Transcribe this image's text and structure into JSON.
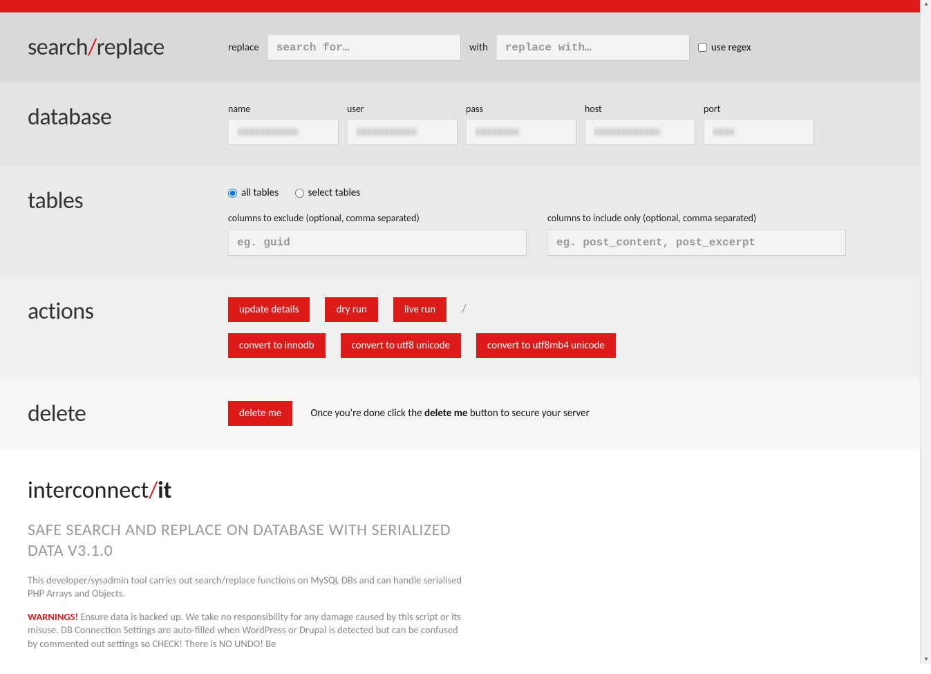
{
  "header": {
    "title_part1": "search",
    "title_slash": "/",
    "title_part2": "replace"
  },
  "replace_row": {
    "replace_label": "replace",
    "search_placeholder": "search for…",
    "with_label": "with",
    "replace_placeholder": "replace with…",
    "regex_label": "use regex"
  },
  "database": {
    "heading": "database",
    "fields": {
      "name_label": "name",
      "user_label": "user",
      "pass_label": "pass",
      "host_label": "host",
      "port_label": "port"
    }
  },
  "tables": {
    "heading": "tables",
    "all_tables_label": "all tables",
    "select_tables_label": "select tables",
    "exclude_label": "columns to exclude (optional, comma separated)",
    "exclude_placeholder": "eg. guid",
    "include_label": "columns to include only (optional, comma separated)",
    "include_placeholder": "eg. post_content, post_excerpt"
  },
  "actions": {
    "heading": "actions",
    "update_details": "update details",
    "dry_run": "dry run",
    "live_run": "live run",
    "separator": "/",
    "convert_innodb": "convert to innodb",
    "convert_utf8": "convert to utf8 unicode",
    "convert_utf8mb4": "convert to utf8mb4 unicode"
  },
  "delete": {
    "heading": "delete",
    "button": "delete me",
    "note_before": "Once you're done click the ",
    "note_bold": "delete me",
    "note_after": " button to secure your server"
  },
  "footer": {
    "brand_part1": "interconnect",
    "brand_slash": "/",
    "brand_part2": "it",
    "subtitle": "SAFE SEARCH AND REPLACE ON DATABASE WITH SERIALIZED DATA V3.1.0",
    "para1": "This developer/sysadmin tool carries out search/replace functions on MySQL DBs and can handle serialised PHP Arrays and Objects.",
    "warn_label": "WARNINGS!",
    "para2": " Ensure data is backed up. We take no responsibility for any damage caused by this script or its misuse. DB Connection Settings are auto-filled when WordPress or Drupal is detected but can be confused by commented out settings so CHECK! There is NO UNDO! Be"
  }
}
